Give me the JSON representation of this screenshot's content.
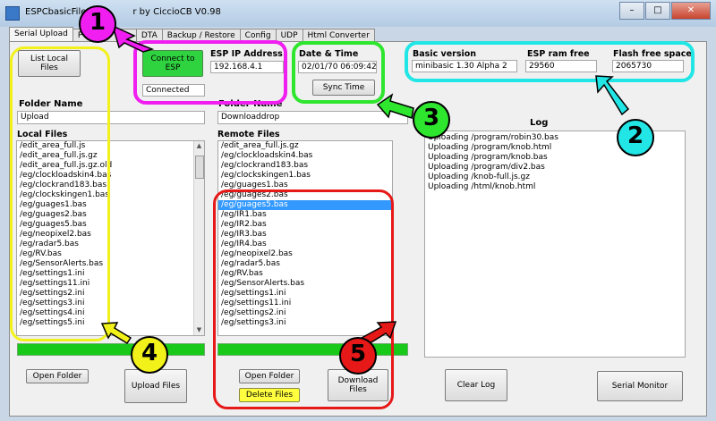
{
  "window": {
    "title": "ESPCbasicFile",
    "title_suffix": "r by CiccioCB V0.98",
    "minimize": "–",
    "maximize": "□",
    "close": "✕"
  },
  "tabs": [
    "Serial Upload",
    "P",
    "DTA",
    "Backup / Restore",
    "Config",
    "UDP",
    "Html Converter"
  ],
  "list_local_button": "List Local Files",
  "connect_button": "Connect to ESP",
  "connection_status": "Connected",
  "ip": {
    "label": "ESP IP Address",
    "value": "192.168.4.1"
  },
  "datetime": {
    "label": "Date & Time",
    "value": "02/01/70 06:09:42",
    "sync_button": "Sync Time"
  },
  "info": {
    "basic_version_label": "Basic version",
    "basic_version_value": "minibasic 1.30 Alpha 2",
    "ram_label": "ESP ram free",
    "ram_value": "29560",
    "flash_label": "Flash free space",
    "flash_value": "2065730"
  },
  "local": {
    "folder_label": "Folder Name",
    "folder_value": "Upload",
    "files_label": "Local Files",
    "files": [
      "/edit_area_full.js",
      "/edit_area_full.js.gz",
      "/edit_area_full.js.gz.old",
      "/eg/clockloadskin4.bas",
      "/eg/clockrand183.bas",
      "/eg/clockskingen1.bas",
      "/eg/guages1.bas",
      "/eg/guages2.bas",
      "/eg/guages5.bas",
      "/eg/neopixel2.bas",
      "/eg/radar5.bas",
      "/eg/RV.bas",
      "/eg/SensorAlerts.bas",
      "/eg/settings1.ini",
      "/eg/settings11.ini",
      "/eg/settings2.ini",
      "/eg/settings3.ini",
      "/eg/settings4.ini",
      "/eg/settings5.ini"
    ],
    "open_folder": "Open Folder",
    "upload_button": "Upload Files"
  },
  "remote": {
    "folder_label": "Folder Name",
    "folder_value": "Downloaddrop",
    "files_label": "Remote Files",
    "files": [
      "/edit_area_full.js.gz",
      "/eg/clockloadskin4.bas",
      "/eg/clockrand183.bas",
      "/eg/clockskingen1.bas",
      "/eg/guages1.bas",
      "/eg/guages2.bas",
      "/eg/guages5.bas",
      "/eg/IR1.bas",
      "/eg/IR2.bas",
      "/eg/IR3.bas",
      "/eg/IR4.bas",
      "/eg/neopixel2.bas",
      "/eg/radar5.bas",
      "/eg/RV.bas",
      "/eg/SensorAlerts.bas",
      "/eg/settings1.ini",
      "/eg/settings11.ini",
      "/eg/settings2.ini",
      "/eg/settings3.ini"
    ],
    "selected_file": "/eg/guages5.bas",
    "open_folder": "Open Folder",
    "delete_button": "Delete Files",
    "download_button": "Download Files"
  },
  "log": {
    "label": "Log",
    "lines": [
      "Uploading /program/robin30.bas",
      "Uploading /program/knob.html",
      "Uploading /program/knob.bas",
      "Uploading /program/div2.bas",
      "Uploading /knob-full.js.gz",
      "Uploading /html/knob.html"
    ],
    "clear_button": "Clear Log"
  },
  "serial_monitor_button": "Serial Monitor",
  "annotations": [
    {
      "number": "1",
      "color": "#f01ef0"
    },
    {
      "number": "2",
      "color": "#22e6e6"
    },
    {
      "number": "3",
      "color": "#2ee62e"
    },
    {
      "number": "4",
      "color": "#f2f21a"
    },
    {
      "number": "5",
      "color": "#e61818"
    }
  ],
  "colors": {
    "progress": "#19c919",
    "connect_button": "#2fd33f",
    "selection": "#3399ff",
    "delete_button": "#ffff40"
  }
}
